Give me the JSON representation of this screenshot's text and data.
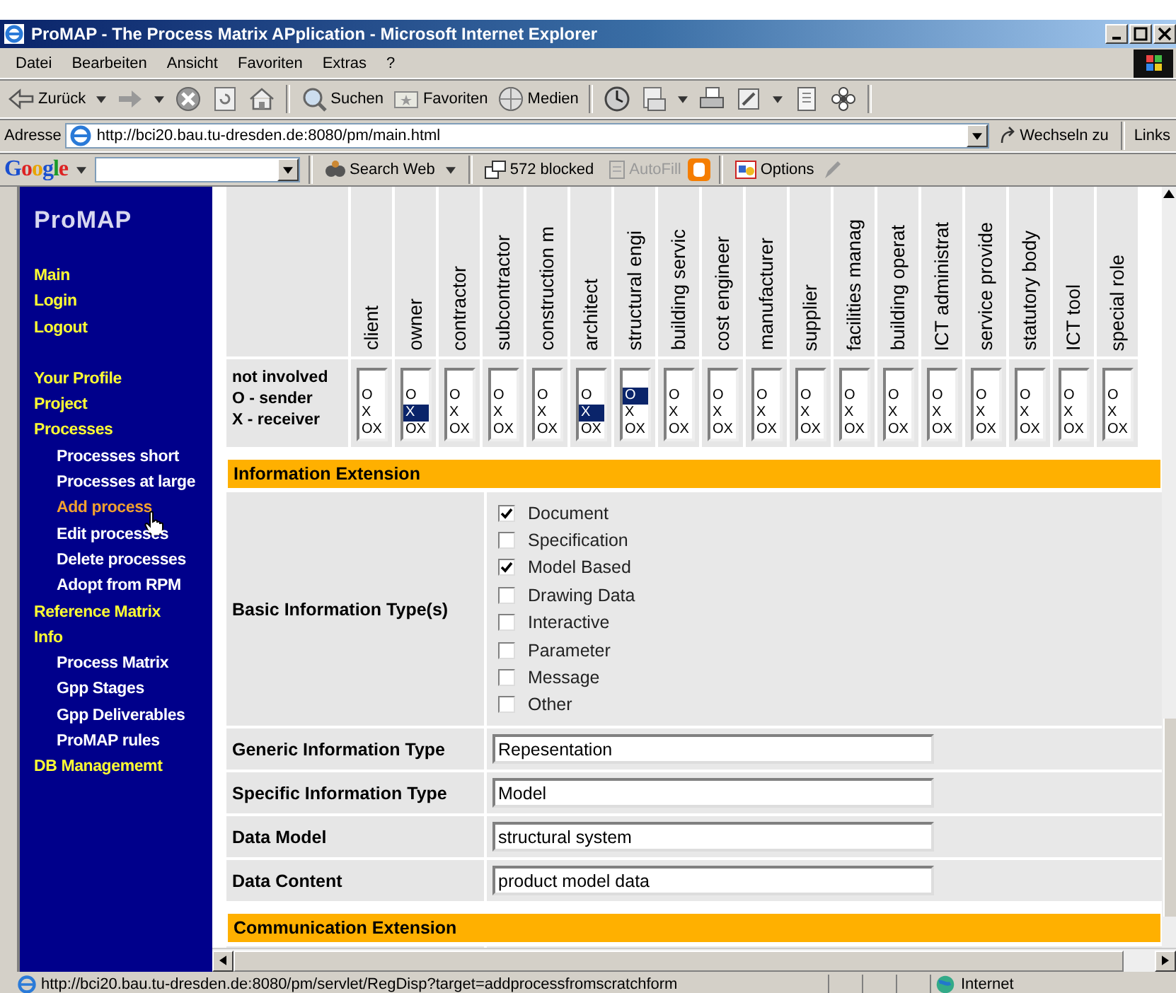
{
  "window": {
    "title": "ProMAP - The Process Matrix APplication - Microsoft Internet Explorer"
  },
  "menu": [
    "Datei",
    "Bearbeiten",
    "Ansicht",
    "Favoriten",
    "Extras",
    "?"
  ],
  "toolbar": [
    {
      "kind": "back",
      "label": "Zurück"
    },
    {
      "kind": "forward"
    },
    {
      "kind": "stop"
    },
    {
      "kind": "refresh"
    },
    {
      "kind": "home"
    },
    {
      "kind": "search",
      "label": "Suchen"
    },
    {
      "kind": "favorites",
      "label": "Favoriten"
    },
    {
      "kind": "media",
      "label": "Medien"
    },
    {
      "kind": "history"
    },
    {
      "kind": "mail"
    },
    {
      "kind": "print"
    },
    {
      "kind": "edit"
    },
    {
      "kind": "page"
    },
    {
      "kind": "flower"
    }
  ],
  "address": {
    "label": "Adresse",
    "url": "http://bci20.bau.tu-dresden.de:8080/pm/main.html",
    "go": "Wechseln zu",
    "links": "Links"
  },
  "google_bar": {
    "logo": "Google",
    "search_button": "Search Web",
    "blocked": "572 blocked",
    "autofill": "AutoFill",
    "options": "Options"
  },
  "sidebar": {
    "title": "ProMAP",
    "groups": [
      {
        "items": [
          {
            "label": "Main",
            "selected": false
          },
          {
            "label": "Login",
            "selected": false
          },
          {
            "label": "Logout",
            "selected": false
          }
        ]
      },
      {
        "items": [
          {
            "label": "Your Profile",
            "selected": false
          },
          {
            "label": "Project",
            "selected": false
          },
          {
            "label": "Processes",
            "selected": false,
            "children": [
              {
                "label": "Processes short",
                "selected": false
              },
              {
                "label": "Processes at large",
                "selected": false
              },
              {
                "label": "Add process",
                "selected": true
              },
              {
                "label": "Edit processes",
                "selected": false
              },
              {
                "label": "Delete processes",
                "selected": false
              },
              {
                "label": "Adopt from RPM",
                "selected": false
              }
            ]
          },
          {
            "label": "Reference Matrix",
            "selected": false
          },
          {
            "label": "Info",
            "selected": false,
            "children": [
              {
                "label": "Process Matrix",
                "selected": false
              },
              {
                "label": "Gpp Stages",
                "selected": false
              },
              {
                "label": "Gpp Deliverables",
                "selected": false
              },
              {
                "label": "ProMAP rules",
                "selected": false
              }
            ]
          },
          {
            "label": "DB Managememt",
            "selected": false
          }
        ]
      }
    ]
  },
  "matrix": {
    "legend": [
      "not involved",
      "O - sender",
      "X - receiver"
    ],
    "roles": [
      {
        "label": "client",
        "options": [
          {
            "text": "O",
            "selected": false
          },
          {
            "text": "X",
            "selected": false
          },
          {
            "text": "OX",
            "selected": false
          }
        ]
      },
      {
        "label": "owner",
        "options": [
          {
            "text": "O",
            "selected": false
          },
          {
            "text": "X",
            "selected": true
          },
          {
            "text": "OX",
            "selected": false
          }
        ]
      },
      {
        "label": "contractor",
        "options": [
          {
            "text": "O",
            "selected": false
          },
          {
            "text": "X",
            "selected": false
          },
          {
            "text": "OX",
            "selected": false
          }
        ]
      },
      {
        "label": "subcontractor",
        "options": [
          {
            "text": "O",
            "selected": false
          },
          {
            "text": "X",
            "selected": false
          },
          {
            "text": "OX",
            "selected": false
          }
        ]
      },
      {
        "label": "construction m",
        "options": [
          {
            "text": "O",
            "selected": false
          },
          {
            "text": "X",
            "selected": false
          },
          {
            "text": "OX",
            "selected": false
          }
        ]
      },
      {
        "label": "architect",
        "options": [
          {
            "text": "O",
            "selected": false
          },
          {
            "text": "X",
            "selected": true
          },
          {
            "text": "OX",
            "selected": false
          }
        ]
      },
      {
        "label": "structural engi",
        "options": [
          {
            "text": "O",
            "selected": true
          },
          {
            "text": "X",
            "selected": false
          },
          {
            "text": "OX",
            "selected": false
          }
        ]
      },
      {
        "label": "building servic",
        "options": [
          {
            "text": "O",
            "selected": false
          },
          {
            "text": "X",
            "selected": false
          },
          {
            "text": "OX",
            "selected": false
          }
        ]
      },
      {
        "label": "cost engineer",
        "options": [
          {
            "text": "O",
            "selected": false
          },
          {
            "text": "X",
            "selected": false
          },
          {
            "text": "OX",
            "selected": false
          }
        ]
      },
      {
        "label": "manufacturer",
        "options": [
          {
            "text": "O",
            "selected": false
          },
          {
            "text": "X",
            "selected": false
          },
          {
            "text": "OX",
            "selected": false
          }
        ]
      },
      {
        "label": "supplier",
        "options": [
          {
            "text": "O",
            "selected": false
          },
          {
            "text": "X",
            "selected": false
          },
          {
            "text": "OX",
            "selected": false
          }
        ]
      },
      {
        "label": "facilities manag",
        "options": [
          {
            "text": "O",
            "selected": false
          },
          {
            "text": "X",
            "selected": false
          },
          {
            "text": "OX",
            "selected": false
          }
        ]
      },
      {
        "label": "building operat",
        "options": [
          {
            "text": "O",
            "selected": false
          },
          {
            "text": "X",
            "selected": false
          },
          {
            "text": "OX",
            "selected": false
          }
        ]
      },
      {
        "label": "ICT administrat",
        "options": [
          {
            "text": "O",
            "selected": false
          },
          {
            "text": "X",
            "selected": false
          },
          {
            "text": "OX",
            "selected": false
          }
        ]
      },
      {
        "label": "service provide",
        "options": [
          {
            "text": "O",
            "selected": false
          },
          {
            "text": "X",
            "selected": false
          },
          {
            "text": "OX",
            "selected": false
          }
        ]
      },
      {
        "label": "statutory body",
        "options": [
          {
            "text": "O",
            "selected": false
          },
          {
            "text": "X",
            "selected": false
          },
          {
            "text": "OX",
            "selected": false
          }
        ]
      },
      {
        "label": "ICT tool",
        "options": [
          {
            "text": "O",
            "selected": false
          },
          {
            "text": "X",
            "selected": false
          },
          {
            "text": "OX",
            "selected": false
          }
        ]
      },
      {
        "label": "special role",
        "options": [
          {
            "text": "O",
            "selected": false
          },
          {
            "text": "X",
            "selected": false
          },
          {
            "text": "OX",
            "selected": false
          }
        ]
      }
    ]
  },
  "sections": [
    {
      "title": "Information Extension",
      "rows": [
        {
          "kind": "checkboxes",
          "label": "Basic Information Type(s)",
          "options": [
            {
              "label": "Document",
              "checked": true
            },
            {
              "label": "Specification",
              "checked": false
            },
            {
              "label": "Model Based",
              "checked": true
            },
            {
              "label": "Drawing Data",
              "checked": false
            },
            {
              "label": "Interactive",
              "checked": false
            },
            {
              "label": "Parameter",
              "checked": false
            },
            {
              "label": "Message",
              "checked": false
            },
            {
              "label": "Other",
              "checked": false
            }
          ]
        },
        {
          "kind": "text",
          "label": "Generic Information Type",
          "value": "Repesentation"
        },
        {
          "kind": "text",
          "label": "Specific Information Type",
          "value": "Model"
        },
        {
          "kind": "text",
          "label": "Data Model",
          "value": "structural system"
        },
        {
          "kind": "text",
          "label": "Data Content",
          "value": "product model data"
        }
      ]
    },
    {
      "title": "Communication Extension",
      "rows": [
        {
          "kind": "blank"
        }
      ]
    }
  ],
  "status_bar": {
    "url": "http://bci20.bau.tu-dresden.de:8080/pm/servlet/RegDisp?target=addprocessfromscratchform",
    "zone": "Internet"
  }
}
